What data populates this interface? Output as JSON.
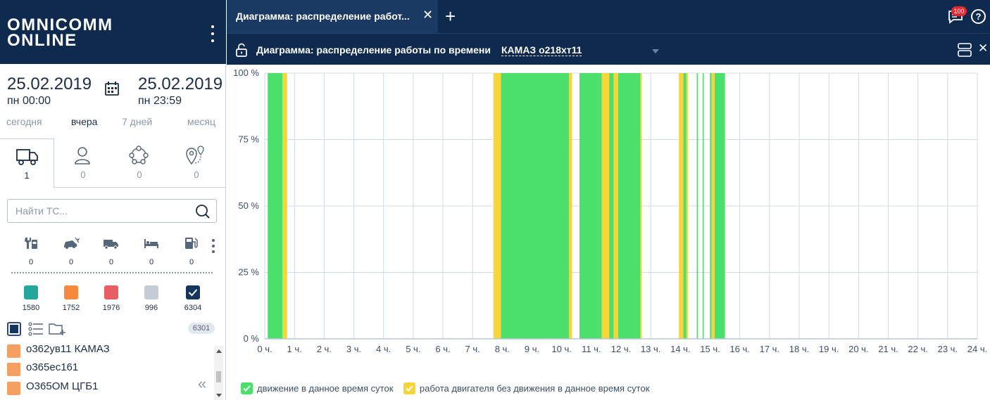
{
  "brand": {
    "line1": "OMNICOMM",
    "line2": "ONLINE"
  },
  "period": {
    "from_date": "25.02.2019",
    "from_time": "пн 00:00",
    "to_date": "25.02.2019",
    "to_time": "пн 23:59",
    "quick": [
      "сегодня",
      "вчера",
      "7 дней",
      "месяц"
    ],
    "quick_active": 1
  },
  "object_tabs": [
    {
      "icon": "truck-icon",
      "count": "1"
    },
    {
      "icon": "user-icon",
      "count": "0"
    },
    {
      "icon": "group-icon",
      "count": "0"
    },
    {
      "icon": "geozone-icon",
      "count": "0"
    }
  ],
  "search": {
    "placeholder": "Найти ТС..."
  },
  "status_filters": [
    {
      "icon": "service-icon",
      "count": "0"
    },
    {
      "icon": "car-crash-icon",
      "count": "0"
    },
    {
      "icon": "truck-small-icon",
      "count": "0"
    },
    {
      "icon": "bed-icon",
      "count": "0"
    },
    {
      "icon": "fuel-icon",
      "count": "0"
    }
  ],
  "color_filters": [
    {
      "color": "#26a69a",
      "count": "1580"
    },
    {
      "color": "#f58a3c",
      "count": "1752"
    },
    {
      "color": "#e85d63",
      "count": "1976"
    },
    {
      "color": "#c5ccd4",
      "count": "996"
    },
    {
      "color": "#14365e",
      "count": "6304",
      "checked": true
    }
  ],
  "list_count": "6301",
  "vehicles": [
    "о362ув11 КАМАЗ",
    "о365ес161",
    "О365ОМ ЦГБ1"
  ],
  "main": {
    "tab_title": "Диаграмма: распределение работ...",
    "title": "Диаграмма: распределение работы по времени",
    "vehicle": "КАМАЗ о218хт11",
    "notifications": "100",
    "help": "?"
  },
  "chart_data": {
    "type": "area",
    "title": "",
    "xlabel": "",
    "ylabel": "",
    "xlim": [
      0,
      24
    ],
    "ylim": [
      0,
      100
    ],
    "x_ticks": [
      "0 ч.",
      "1 ч.",
      "2 ч.",
      "3 ч.",
      "4 ч.",
      "5 ч.",
      "6 ч.",
      "7 ч.",
      "8 ч.",
      "9 ч.",
      "10 ч.",
      "11 ч.",
      "12 ч.",
      "13 ч.",
      "14 ч.",
      "15 ч.",
      "16 ч.",
      "17 ч.",
      "18 ч.",
      "19 ч.",
      "20 ч.",
      "21 ч.",
      "22 ч.",
      "23 ч.",
      "24 ч."
    ],
    "y_ticks": [
      "0 %",
      "25 %",
      "50 %",
      "75 %",
      "100 %"
    ],
    "grid": true,
    "legend_position": "bottom-left",
    "series": [
      {
        "name": "движение в данное время суток",
        "color": "#4cdf6c",
        "intervals_hours": [
          [
            0.1,
            0.6
          ],
          [
            7.95,
            10.25
          ],
          [
            10.6,
            11.35
          ],
          [
            11.6,
            11.75
          ],
          [
            11.9,
            12.65
          ],
          [
            14.1,
            14.2
          ],
          [
            14.55,
            14.58
          ],
          [
            14.75,
            14.78
          ],
          [
            15.0,
            15.05
          ],
          [
            15.15,
            15.5
          ]
        ]
      },
      {
        "name": "работа двигателя без движения в данное время суток",
        "color": "#f7d539",
        "intervals_hours": [
          [
            0.6,
            0.75
          ],
          [
            7.7,
            7.95
          ],
          [
            10.25,
            10.35
          ],
          [
            11.35,
            11.6
          ],
          [
            11.75,
            11.9
          ],
          [
            12.65,
            12.7
          ],
          [
            13.95,
            14.1
          ],
          [
            14.2,
            14.25
          ],
          [
            15.05,
            15.15
          ]
        ]
      }
    ]
  }
}
